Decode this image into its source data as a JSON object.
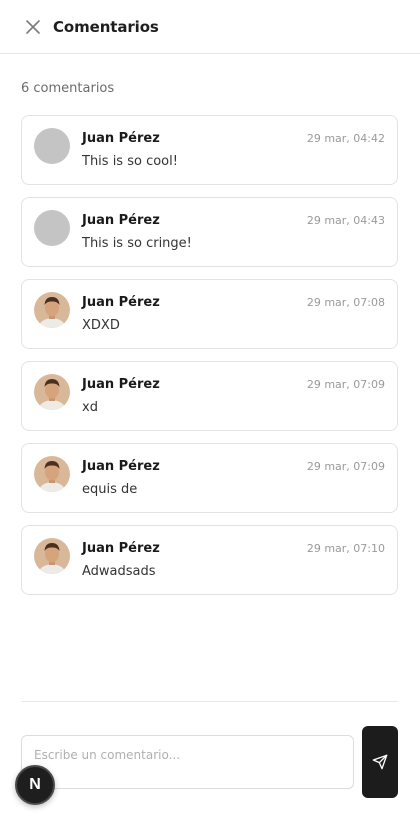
{
  "header": {
    "title": "Comentarios",
    "close_icon": "close-icon"
  },
  "comments_count": "6 comentarios",
  "comments": [
    {
      "author": "Juan Pérez",
      "time": "29 mar, 04:42",
      "text": "This is so cool!",
      "avatar": "placeholder"
    },
    {
      "author": "Juan Pérez",
      "time": "29 mar, 04:43",
      "text": "This is so cringe!",
      "avatar": "placeholder"
    },
    {
      "author": "Juan Pérez",
      "time": "29 mar, 07:08",
      "text": "XDXD",
      "avatar": "photo"
    },
    {
      "author": "Juan Pérez",
      "time": "29 mar, 07:09",
      "text": "xd",
      "avatar": "photo"
    },
    {
      "author": "Juan Pérez",
      "time": "29 mar, 07:09",
      "text": "equis de",
      "avatar": "photo"
    },
    {
      "author": "Juan Pérez",
      "time": "29 mar, 07:10",
      "text": "Adwadsads",
      "avatar": "photo"
    }
  ],
  "composer": {
    "placeholder": "Escribe un comentario...",
    "value": "",
    "send_icon": "send-icon"
  },
  "dev_badge": {
    "label": "N"
  }
}
